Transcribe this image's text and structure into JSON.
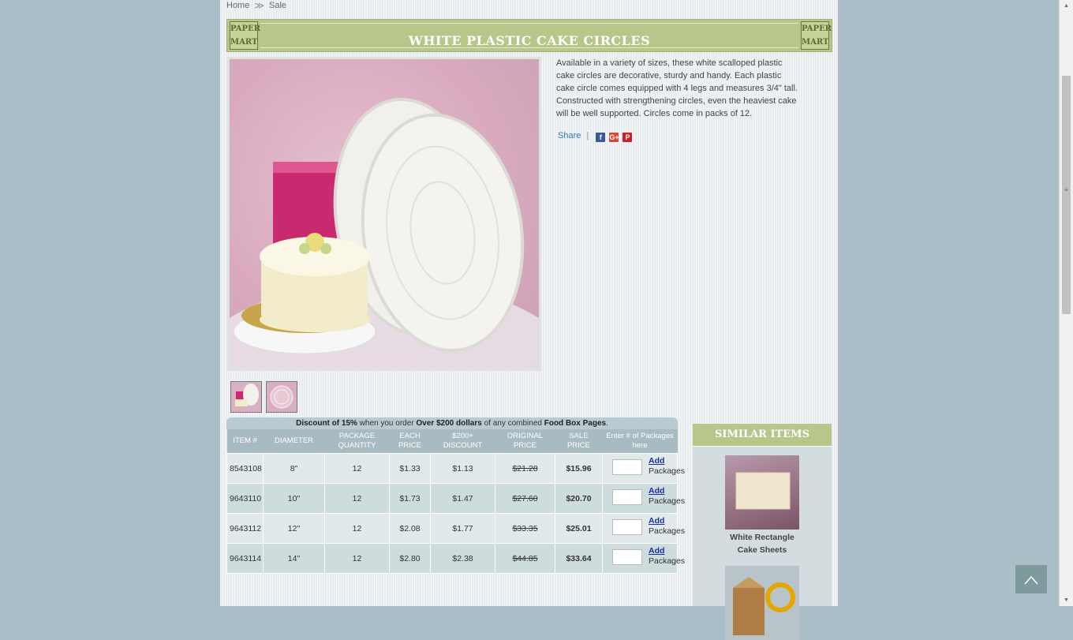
{
  "breadcrumb": {
    "home": "Home",
    "sep": "≫",
    "current": "Sale"
  },
  "product": {
    "title": "WHITE PLASTIC CAKE CIRCLES",
    "logo_line1": "PAPER",
    "logo_line2": "MART",
    "description": "Available in a variety of sizes, these white scalloped plastic cake circles are decorative, sturdy and handy. Each plastic cake circle comes equipped with 4 legs and measures 3/4\" tall. Constructed with strengthening circles, even the heaviest cake will be well supported. Circles come in packs of 12.",
    "share_label": "Share",
    "share_sep": "|",
    "social": {
      "facebook": "f",
      "google": "G+",
      "pinterest": "P"
    }
  },
  "discount": {
    "part1": "Discount of ",
    "percent": "15%",
    "part2": " when you order ",
    "threshold": "Over $200 dollars",
    "part3": " of any combined ",
    "category": "Food Box Pages",
    "part4": "."
  },
  "table": {
    "headers": {
      "item": "ITEM #",
      "diameter": "DIAMETER",
      "package_qty_1": "PACKAGE",
      "package_qty_2": "QUANTITY",
      "each_1": "EACH",
      "each_2": "PRICE",
      "discount_1": "$200+",
      "discount_2": "DISCOUNT",
      "original_1": "ORIGINAL",
      "original_2": "PRICE",
      "sale_1": "SALE",
      "sale_2": "PRICE",
      "enter": "Enter # of Packages here"
    },
    "add_label": "Add",
    "packages_label": "Packages",
    "rows": [
      {
        "item": "8543108",
        "diameter": "8\"",
        "qty": "12",
        "each": "$1.33",
        "discount": "$1.13",
        "original": "$21.28",
        "sale": "$15.96"
      },
      {
        "item": "9643110",
        "diameter": "10\"",
        "qty": "12",
        "each": "$1.73",
        "discount": "$1.47",
        "original": "$27.60",
        "sale": "$20.70"
      },
      {
        "item": "9643112",
        "diameter": "12\"",
        "qty": "12",
        "each": "$2.08",
        "discount": "$1.77",
        "original": "$33.35",
        "sale": "$25.01"
      },
      {
        "item": "9643114",
        "diameter": "14\"",
        "qty": "12",
        "each": "$2.80",
        "discount": "$2.38",
        "original": "$44.85",
        "sale": "$33.64"
      }
    ]
  },
  "similar": {
    "header": "SIMILAR ITEMS",
    "items": [
      {
        "name_line1": "White Rectangle",
        "name_line2": "Cake Sheets"
      }
    ]
  },
  "colors": {
    "page_bg": "#a9bec6",
    "title_bar": "#b8c68a",
    "table_header": "#a8bbc2",
    "link": "#1a2f9e"
  }
}
